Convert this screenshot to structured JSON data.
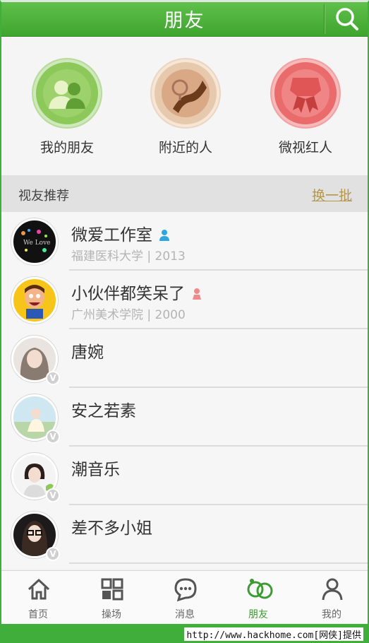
{
  "header": {
    "title": "朋友",
    "search_icon": "search-icon"
  },
  "features": [
    {
      "label": "我的朋友",
      "icon": "friends-icon"
    },
    {
      "label": "附近的人",
      "icon": "map-icon"
    },
    {
      "label": "微视红人",
      "icon": "ribbon-icon"
    }
  ],
  "recommend": {
    "title": "视友推荐",
    "action": "换一批"
  },
  "list": [
    {
      "name": "微爱工作室",
      "sub": "福建医科大学 | 2013",
      "gender": "male"
    },
    {
      "name": "小伙伴都笑呆了",
      "sub": "广州美术学院 | 2000",
      "gender": "female"
    },
    {
      "name": "唐婉",
      "sub": "",
      "badge": "V"
    },
    {
      "name": "安之若素",
      "sub": "",
      "badge": "V"
    },
    {
      "name": "潮音乐",
      "sub": "",
      "badge": "V"
    },
    {
      "name": "差不多小姐",
      "sub": "",
      "badge": "V"
    }
  ],
  "tabs": [
    {
      "label": "首页",
      "icon": "home-icon"
    },
    {
      "label": "操场",
      "icon": "grid-icon"
    },
    {
      "label": "消息",
      "icon": "message-icon"
    },
    {
      "label": "朋友",
      "icon": "friends-rings-icon",
      "active": true
    },
    {
      "label": "我的",
      "icon": "profile-icon"
    }
  ],
  "watermark": "http://www.hackhome.com[网侠]提供",
  "colors": {
    "brand_green": "#3fa52f",
    "action_gold": "#b6974a",
    "male_blue": "#2ea7e0",
    "female_pink": "#f08a8a"
  }
}
